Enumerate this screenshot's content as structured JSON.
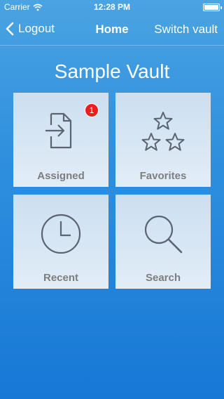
{
  "status_bar": {
    "carrier": "Carrier",
    "time": "12:28 PM"
  },
  "nav": {
    "back_label": "Logout",
    "title": "Home",
    "right_label": "Switch vault"
  },
  "vault_name": "Sample Vault",
  "tiles": [
    {
      "label": "Assigned",
      "icon": "document-import-icon",
      "badge": "1"
    },
    {
      "label": "Favorites",
      "icon": "stars-icon"
    },
    {
      "label": "Recent",
      "icon": "clock-icon"
    },
    {
      "label": "Search",
      "icon": "magnifier-icon"
    }
  ],
  "colors": {
    "background_top": "#4aa3e2",
    "background_bottom": "#1778d6",
    "tile_icon": "#5b6470",
    "badge": "#ef1c1c"
  }
}
